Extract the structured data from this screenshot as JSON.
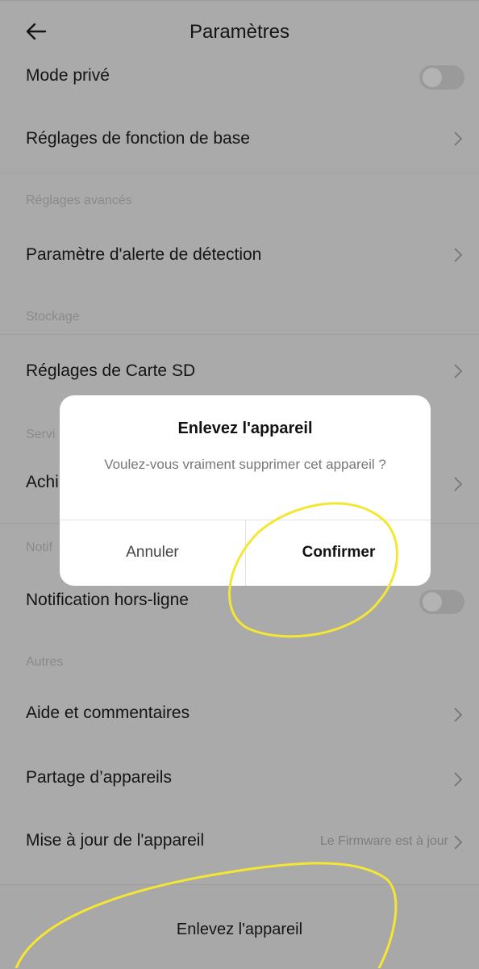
{
  "header": {
    "title": "Paramètres"
  },
  "rows": {
    "private_mode": "Mode privé",
    "basic_settings": "Réglages de fonction de base",
    "advanced_section": "Réglages avancés",
    "detection_alert": "Paramètre d'alerte de détection",
    "storage_section": "Stockage",
    "sd_card": "Réglages de Carte SD",
    "services_section": "Servi",
    "purchase": "Achi",
    "notif_section": "Notif",
    "offline_notif": "Notification hors-ligne",
    "others_section": "Autres",
    "help": "Aide et commentaires",
    "sharing": "Partage d’appareils",
    "update": "Mise à jour de l'appareil",
    "update_value": "Le Firmware est à jour"
  },
  "bottom": {
    "remove_label": "Enlevez l'appareil"
  },
  "dialog": {
    "title": "Enlevez l'appareil",
    "message": "Voulez-vous vraiment supprimer cet appareil ?",
    "cancel": "Annuler",
    "confirm": "Confirmer"
  },
  "icons": {
    "back": "arrow-left-icon",
    "chevron": "chevron-right-icon",
    "toggle": "toggle-switch"
  },
  "colors": {
    "overlay": "#aaaaaa",
    "dialog_bg": "#ffffff",
    "annotation": "#f5e634",
    "muted": "#8a8a8a"
  }
}
